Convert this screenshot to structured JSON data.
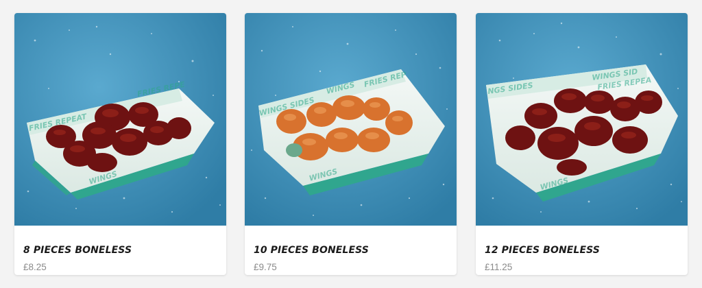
{
  "products": [
    {
      "title": "8 PIECES BONELESS",
      "price": "£8.25",
      "sauce": "bbq",
      "tray_text": "FRIES REPEAT · SIDES · WINGS"
    },
    {
      "title": "10 PIECES BONELESS",
      "price": "£9.75",
      "sauce": "plain",
      "tray_text": "WINGS · SIDES · FRIES REPEAT"
    },
    {
      "title": "12 PIECES BONELESS",
      "price": "£11.25",
      "sauce": "bbq",
      "tray_text": "WINGS · SIDES · FRIES REPEAT"
    }
  ],
  "colors": {
    "background_blue": "#3b8db4",
    "bbq_sauce": "#6e1212",
    "crispy_coating": "#d8722e",
    "tray_green": "#2fa88a",
    "tray_paper": "#eef4f1"
  },
  "icons": [
    "wings-photo"
  ]
}
